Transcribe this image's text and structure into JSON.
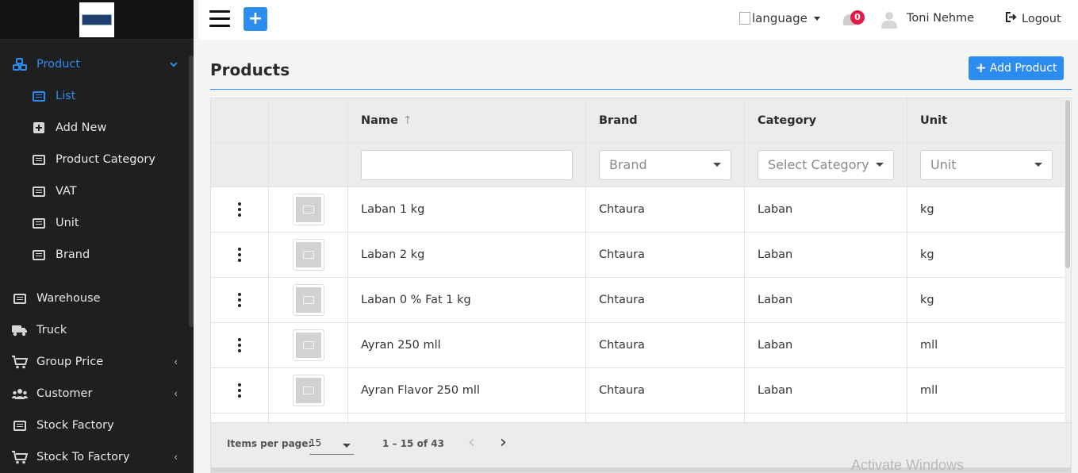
{
  "sidebar": {
    "items": [
      {
        "label": "Product",
        "icon": "cubes-icon",
        "type": "top",
        "active": true,
        "caret": "⌄"
      },
      {
        "label": "List",
        "icon": "list-icon",
        "type": "sub",
        "active": true
      },
      {
        "label": "Add New",
        "icon": "plus-square-icon",
        "type": "sub"
      },
      {
        "label": "Product Category",
        "icon": "list-icon",
        "type": "sub"
      },
      {
        "label": "VAT",
        "icon": "list-icon",
        "type": "sub"
      },
      {
        "label": "Unit",
        "icon": "list-icon",
        "type": "sub"
      },
      {
        "label": "Brand",
        "icon": "list-icon",
        "type": "sub"
      },
      {
        "label": "Warehouse",
        "icon": "list-icon",
        "type": "top"
      },
      {
        "label": "Truck",
        "icon": "truck-icon",
        "type": "top"
      },
      {
        "label": "Group Price",
        "icon": "cart-icon",
        "type": "top",
        "caret": "‹"
      },
      {
        "label": "Customer",
        "icon": "users-icon",
        "type": "top",
        "caret": "‹"
      },
      {
        "label": "Stock Factory",
        "icon": "list-icon",
        "type": "top"
      },
      {
        "label": "Stock To Factory",
        "icon": "cart-icon",
        "type": "top",
        "caret": "‹"
      }
    ]
  },
  "header": {
    "language_label": "language",
    "notification_count": "0",
    "user_name": "Toni Nehme",
    "logout_label": "Logout"
  },
  "page": {
    "title": "Products",
    "add_button_label": "Add Product"
  },
  "table": {
    "columns": [
      "",
      "",
      "Name",
      "Brand",
      "Category",
      "Unit"
    ],
    "sort_indicator": "↑",
    "filters": {
      "name_value": "",
      "brand_placeholder": "Brand",
      "category_placeholder": "Select Category",
      "unit_placeholder": "Unit"
    },
    "rows": [
      {
        "name": "Laban 1 kg",
        "brand": "Chtaura",
        "category": "Laban",
        "unit": "kg"
      },
      {
        "name": "Laban 2 kg",
        "brand": "Chtaura",
        "category": "Laban",
        "unit": "kg"
      },
      {
        "name": "Laban 0 % Fat 1 kg",
        "brand": "Chtaura",
        "category": "Laban",
        "unit": "kg"
      },
      {
        "name": "Ayran 250 mll",
        "brand": "Chtaura",
        "category": "Laban",
        "unit": "mll"
      },
      {
        "name": "Ayran Flavor 250 mll",
        "brand": "Chtaura",
        "category": "Laban",
        "unit": "mll"
      }
    ]
  },
  "paginator": {
    "items_per_page_label": "Items per page:",
    "items_per_page_value": "15",
    "range_label": "1 – 15 of 43",
    "prev_glyph": "‹",
    "next_glyph": "›"
  },
  "watermark": "Activate Windows",
  "colors": {
    "accent": "#2d8cf0",
    "sidebar_bg": "#1f1f1f",
    "badge": "#e5194a"
  }
}
